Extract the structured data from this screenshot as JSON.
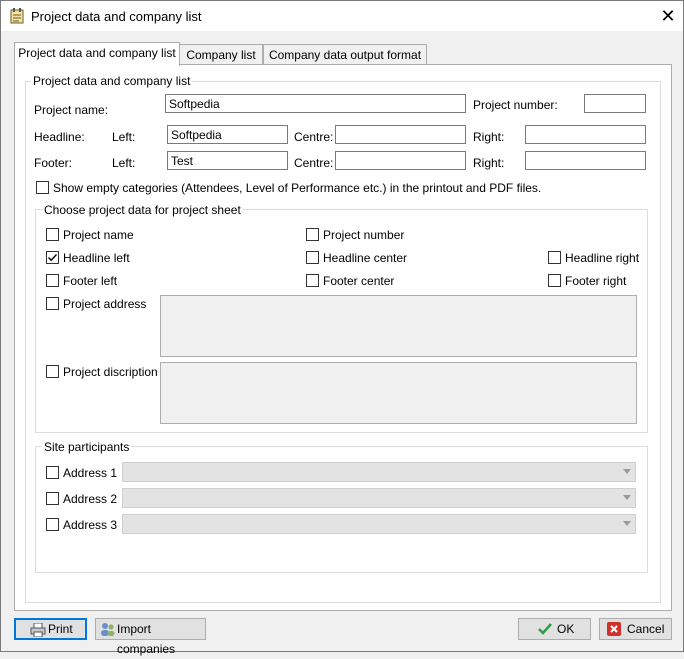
{
  "window": {
    "title": "Project data and company list"
  },
  "tabs": [
    {
      "label": "Project data and company list",
      "active": true
    },
    {
      "label": "Company list",
      "active": false
    },
    {
      "label": "Company data output format",
      "active": false
    }
  ],
  "project_group": {
    "title": "Project data and company list",
    "project_name_label": "Project name:",
    "project_name_value": "Softpedia",
    "project_number_label": "Project number:",
    "project_number_value": "",
    "headline_label": "Headline:",
    "footer_label": "Footer:",
    "left_label": "Left:",
    "centre_label": "Centre:",
    "right_label": "Right:",
    "headline_left": "Softpedia",
    "headline_centre": "",
    "headline_right": "",
    "footer_left": "Test",
    "footer_centre": "",
    "footer_right": "",
    "show_empty_label": "Show empty categories (Attendees, Level of Performance etc.) in the printout and PDF files.",
    "show_empty_checked": false
  },
  "project_sheet": {
    "title": "Choose project data for project sheet",
    "project_name": {
      "label": "Project name",
      "checked": false
    },
    "project_number": {
      "label": "Project number",
      "checked": false
    },
    "headline_left": {
      "label": "Headline left",
      "checked": true
    },
    "headline_center": {
      "label": "Headline center",
      "checked": false
    },
    "headline_right": {
      "label": "Headline right",
      "checked": false
    },
    "footer_left": {
      "label": "Footer left",
      "checked": false
    },
    "footer_center": {
      "label": "Footer center",
      "checked": false
    },
    "footer_right": {
      "label": "Footer right",
      "checked": false
    },
    "project_address": {
      "label": "Project address",
      "checked": false
    },
    "project_discription": {
      "label": "Project discription",
      "checked": false
    }
  },
  "site_participants": {
    "title": "Site participants",
    "addresses": [
      {
        "label": "Address 1",
        "checked": false,
        "value": ""
      },
      {
        "label": "Address 2",
        "checked": false,
        "value": ""
      },
      {
        "label": "Address 3",
        "checked": false,
        "value": ""
      }
    ]
  },
  "buttons": {
    "print": "Print",
    "import": "Import companies",
    "ok": "OK",
    "cancel": "Cancel"
  },
  "colors": {
    "accent": "#0078d7",
    "ok_check": "#2ea043",
    "cancel_x": "#d0312d"
  }
}
